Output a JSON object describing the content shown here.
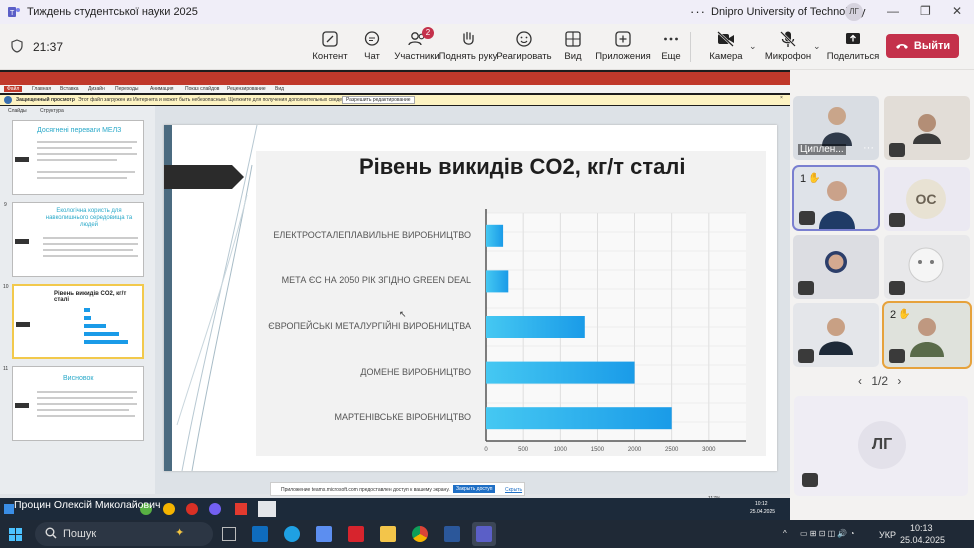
{
  "window": {
    "title": "Тиждень студентської науки 2025",
    "more": "···",
    "org": "Dnipro University of Technology",
    "avatar": "ЛГ",
    "minimize": "—",
    "restore": "❐",
    "close": "✕"
  },
  "toolbar": {
    "timer": "21:37",
    "items": [
      {
        "label": "Контент",
        "icon": "content-icon"
      },
      {
        "label": "Чат",
        "icon": "chat-icon"
      },
      {
        "label": "Участники",
        "icon": "people-icon",
        "badge": "2"
      },
      {
        "label": "Поднять руку",
        "icon": "raise-hand-icon"
      },
      {
        "label": "Реагировать",
        "icon": "react-icon"
      },
      {
        "label": "Вид",
        "icon": "view-icon"
      },
      {
        "label": "Приложения",
        "icon": "apps-icon"
      },
      {
        "label": "Еще",
        "icon": "more-icon"
      },
      {
        "label": "Камера",
        "icon": "camera-off-icon"
      },
      {
        "label": "Микрофон",
        "icon": "mic-off-icon"
      },
      {
        "label": "Поделиться",
        "icon": "share-icon"
      }
    ],
    "leave_label": "Выйти"
  },
  "shared_screen": {
    "presenter": "Процин Олексій Миколайович",
    "ppt_tabs": [
      "Файл",
      "Главная",
      "Вставка",
      "Дизайн",
      "Переходы",
      "Анимация",
      "Показ слайдов",
      "Рецензирование",
      "Вид"
    ],
    "panel_tabs": [
      "Слайды",
      "Структура"
    ],
    "warning_title": "Защищенный просмотр",
    "warning_text": "Этот файл загружен из Интернета и может быть небезопасным. Щелкните для получения дополнительных сведений.",
    "warning_button": "Разрешить редактирование",
    "thumbnails": [
      {
        "num": "",
        "title": "Досягнені переваги МЕЛЗ"
      },
      {
        "num": "9",
        "title": "Екологічна користь для навколишнього середовища та людей"
      },
      {
        "num": "10",
        "title": "Рівень викидів CO2, кг/т сталі"
      },
      {
        "num": "11",
        "title": "Висновок"
      }
    ],
    "teams_notice": "Приложение teams.microsoft.com предоставлен доступ к вашему экрану.",
    "teams_notice_button": "Закрыть доступ",
    "teams_notice_link": "Скрыть",
    "share_clock_time": "10:12",
    "share_clock_date": "25.04.2025",
    "zoom": "117%"
  },
  "chart_data": {
    "type": "bar",
    "orientation": "horizontal",
    "title": "Рівень викидів CO2, кг/т сталі",
    "categories": [
      "ЕЛЕКТРОСТАЛЕПЛАВИЛЬНЕ ВИРОБНИЦТВО",
      "МЕТА ЄС НА 2050 РІК ЗГІДНО GREEN DEAL",
      "ЄВРОПЕЙСЬКІ МЕТАЛУРГІЙНІ ВИРОБНИЦТВА",
      "ДОМЕНЕ ВИРОБНИЦТВО",
      "МАРТЕНІВСЬКЕ ВІРОБНИЦТВО"
    ],
    "values": [
      230,
      300,
      1330,
      2000,
      2500
    ],
    "xticks": [
      "0",
      "500",
      "1000",
      "1500",
      "2000",
      "2500",
      "3000"
    ],
    "xlim": [
      0,
      3500
    ],
    "grid": true,
    "bar_color": "#1a9be8"
  },
  "participants": {
    "tiles": [
      {
        "name": "Циплен...",
        "kind": "video",
        "mic": "on"
      },
      {
        "name": "",
        "kind": "video",
        "mic": "off"
      },
      {
        "name": "",
        "kind": "video",
        "mic": "off",
        "hand": "1",
        "active": true
      },
      {
        "name": "",
        "kind": "initials",
        "initials": "ОС",
        "mic": "off"
      },
      {
        "name": "",
        "kind": "video",
        "mic": "off"
      },
      {
        "name": "",
        "kind": "video",
        "mic": "off"
      },
      {
        "name": "",
        "kind": "video",
        "mic": "off"
      },
      {
        "name": "",
        "kind": "video",
        "mic": "off",
        "hand": "2",
        "speaking": true
      }
    ],
    "pager": "1/2",
    "self_initials": "ЛГ"
  },
  "taskbar": {
    "search_placeholder": "Пошук",
    "lang": "УКР",
    "time": "10:13",
    "date": "25.04.2025"
  }
}
